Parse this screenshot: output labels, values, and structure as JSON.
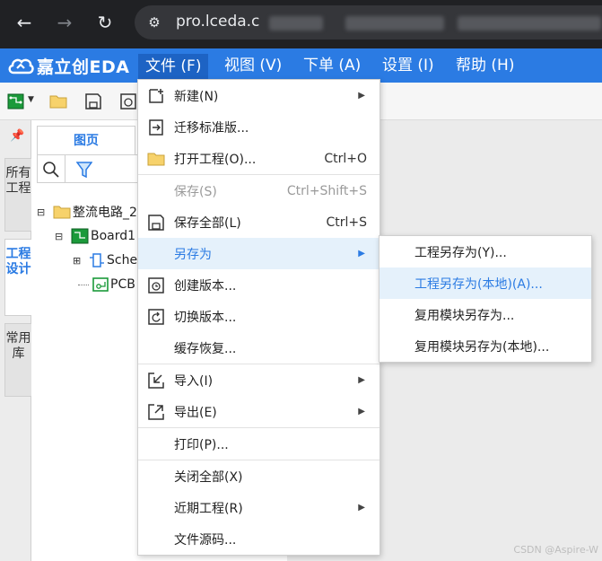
{
  "browser": {
    "url_visible": "pro.lceda.c",
    "back_icon": "arrow-left-icon",
    "forward_icon": "arrow-right-icon",
    "reload_icon": "reload-icon"
  },
  "app": {
    "logo_text": "嘉立创EDA",
    "brand_color": "#2b7be3",
    "menus": [
      {
        "label": "文件 (F)"
      },
      {
        "label": "视图 (V)"
      },
      {
        "label": "下单 (A)"
      },
      {
        "label": "设置 (I)"
      },
      {
        "label": "帮助 (H)"
      }
    ]
  },
  "side_tabs": {
    "all_projects": "所有工程",
    "project_design": "工程设计",
    "common_library": "常用库"
  },
  "panel": {
    "tab_label": "图页",
    "tree": [
      {
        "label": "整流电路_2"
      },
      {
        "label": "Board1"
      },
      {
        "label": "Sche"
      },
      {
        "label": "PCB"
      }
    ]
  },
  "file_menu": {
    "items": [
      {
        "label": "新建(N)",
        "shortcut": "",
        "submenu": true
      },
      {
        "label": "迁移标准版...",
        "shortcut": ""
      },
      {
        "label": "打开工程(O)...",
        "shortcut": "Ctrl+O"
      },
      {
        "label": "保存(S)",
        "shortcut": "Ctrl+Shift+S",
        "disabled": true
      },
      {
        "label": "保存全部(L)",
        "shortcut": "Ctrl+S"
      },
      {
        "label": "另存为",
        "shortcut": "",
        "submenu": true
      },
      {
        "label": "创建版本...",
        "shortcut": ""
      },
      {
        "label": "切换版本...",
        "shortcut": ""
      },
      {
        "label": "缓存恢复...",
        "shortcut": ""
      },
      {
        "label": "导入(I)",
        "shortcut": "",
        "submenu": true
      },
      {
        "label": "导出(E)",
        "shortcut": "",
        "submenu": true
      },
      {
        "label": "打印(P)...",
        "shortcut": ""
      },
      {
        "label": "关闭全部(X)",
        "shortcut": ""
      },
      {
        "label": "近期工程(R)",
        "shortcut": "",
        "submenu": true
      },
      {
        "label": "文件源码...",
        "shortcut": ""
      }
    ]
  },
  "save_as_submenu": {
    "items": [
      {
        "label": "工程另存为(Y)..."
      },
      {
        "label": "工程另存为(本地)(A)..."
      },
      {
        "label": "复用模块另存为..."
      },
      {
        "label": "复用模块另存为(本地)..."
      }
    ]
  },
  "watermark": "CSDN @Aspire-W"
}
